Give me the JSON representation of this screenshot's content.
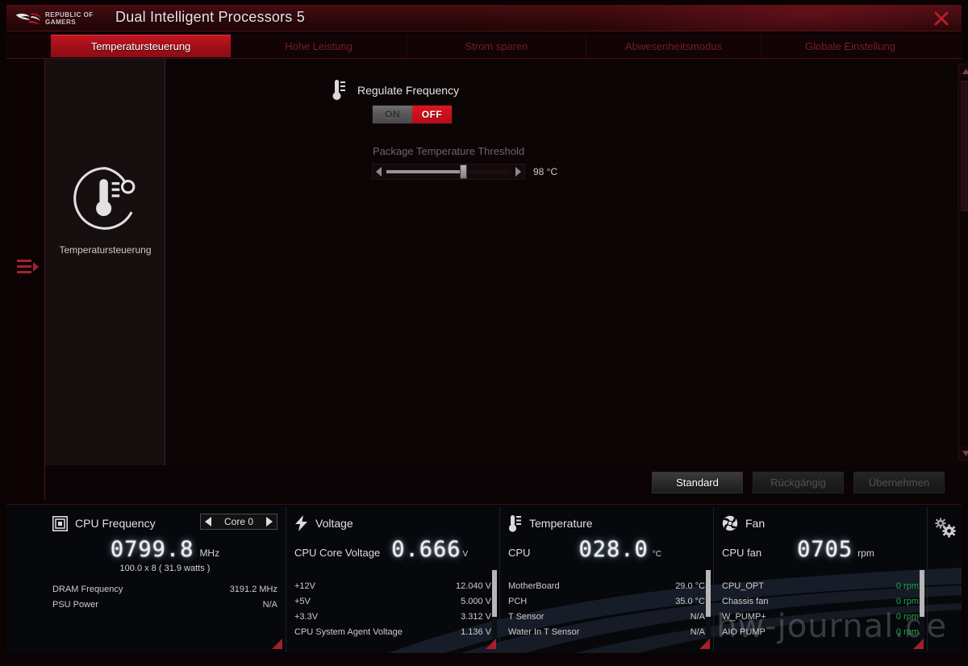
{
  "window": {
    "title": "Dual Intelligent Processors 5",
    "brand_line1": "REPUBLIC OF",
    "brand_line2": "GAMERS",
    "close_label": "×",
    "accent_red": "#c81420",
    "tab_inactive_color": "#7c1e26"
  },
  "tabs": [
    {
      "label": "Temperatursteuerung",
      "active": true
    },
    {
      "label": "Hohe Leistung",
      "active": false
    },
    {
      "label": "Strom sparen",
      "active": false
    },
    {
      "label": "Abwesenheitsmodus",
      "active": false
    },
    {
      "label": "Globale Einstellung",
      "active": false
    }
  ],
  "side_panel": {
    "icon": "thermometer-gauge-icon",
    "label": "Temperatursteuerung"
  },
  "main": {
    "option_title": "Regulate Frequency",
    "option_icon": "thermometer-icon",
    "toggle": {
      "on_label": "ON",
      "off_label": "OFF",
      "selected": "OFF"
    },
    "threshold": {
      "label": "Package Temperature Threshold",
      "value": "98 °C",
      "fill_percent": 62
    }
  },
  "actions": {
    "default_label": "Standard",
    "undo_label": "Rückgängig",
    "apply_label": "Übernehmen",
    "undo_disabled": true,
    "apply_disabled": true
  },
  "monitor": {
    "cpu_frequency": {
      "icon": "cpu-icon",
      "title": "CPU Frequency",
      "core_selector": "Core 0",
      "value": "0799.8",
      "unit": "MHz",
      "sub": "100.0  x  8        ( 31.9 watts )",
      "rows": [
        {
          "label": "DRAM Frequency",
          "value": "3191.2  MHz"
        },
        {
          "label": "PSU Power",
          "value": "N/A"
        }
      ]
    },
    "voltage": {
      "icon": "bolt-icon",
      "title": "Voltage",
      "lead": "CPU Core Voltage",
      "value": "0.666",
      "unit": "V",
      "rows": [
        {
          "label": "+12V",
          "value": "12.040  V"
        },
        {
          "label": "+5V",
          "value": "5.000  V"
        },
        {
          "label": "+3.3V",
          "value": "3.312  V"
        },
        {
          "label": "CPU System Agent Voltage",
          "value": "1.136  V"
        }
      ]
    },
    "temperature": {
      "icon": "thermometer-icon",
      "title": "Temperature",
      "lead": "CPU",
      "value": "028.0",
      "unit": "°C",
      "rows": [
        {
          "label": "MotherBoard",
          "value": "29.0 °C"
        },
        {
          "label": "PCH",
          "value": "35.0 °C"
        },
        {
          "label": "T Sensor",
          "value": "N/A"
        },
        {
          "label": "Water In T Sensor",
          "value": "N/A"
        }
      ]
    },
    "fan": {
      "icon": "fan-icon",
      "title": "Fan",
      "lead": "CPU fan",
      "value": "0705",
      "unit": "rpm",
      "rows": [
        {
          "label": "CPU_OPT",
          "value": "0  rpm"
        },
        {
          "label": "Chassis fan",
          "value": "0  rpm"
        },
        {
          "label": "W_PUMP+",
          "value": "0  rpm"
        },
        {
          "label": "AIO PUMP",
          "value": "0  rpm"
        }
      ]
    },
    "settings_icon": "gears-icon"
  },
  "watermark": "hw-journal.de"
}
